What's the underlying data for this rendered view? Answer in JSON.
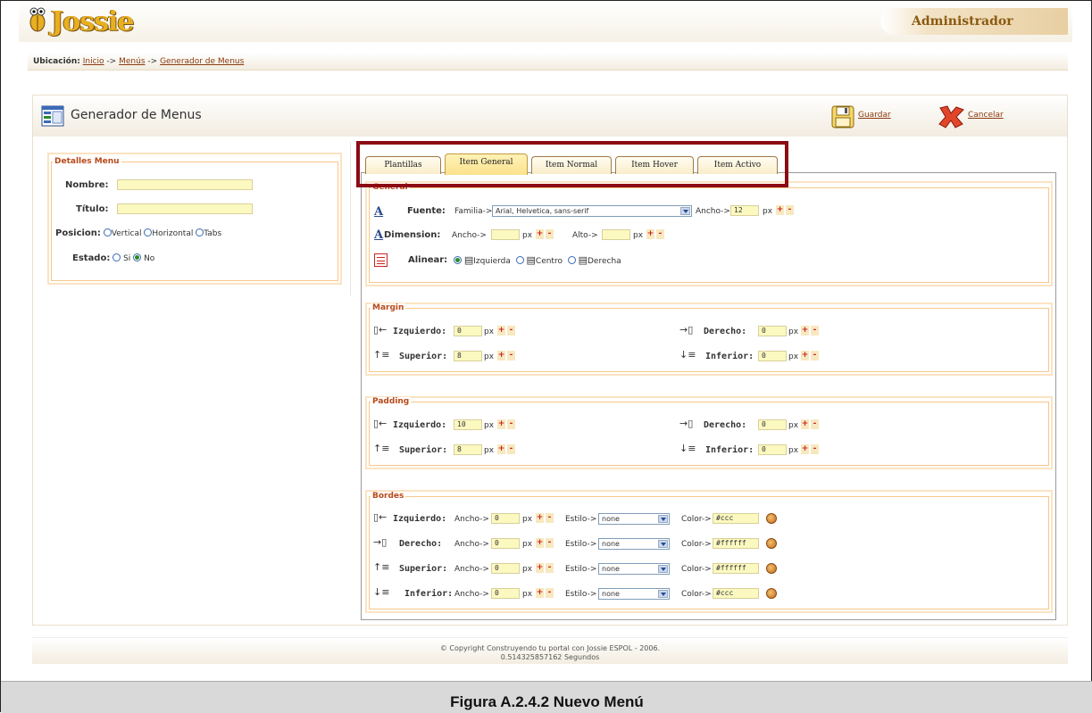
{
  "header": {
    "logo_text": "Jossie",
    "role": "Administrador"
  },
  "breadcrumb": {
    "label": "Ubicación:",
    "items": [
      "Inicio",
      "Menús",
      "Generador de Menus"
    ],
    "separator": "->"
  },
  "page": {
    "title": "Generador de Menus",
    "save_label": "Guardar",
    "cancel_label": "Cancelar"
  },
  "details": {
    "legend": "Detalles Menu",
    "nombre_label": "Nombre:",
    "nombre_value": "",
    "titulo_label": "Título:",
    "titulo_value": "",
    "posicion_label": "Posicion:",
    "posicion_options": [
      "Vertical",
      "Horizontal",
      "Tabs"
    ],
    "estado_label": "Estado:",
    "estado_options": [
      "Si",
      "No"
    ],
    "estado_selected": "No"
  },
  "tabs": [
    {
      "label": "Plantillas",
      "active": false
    },
    {
      "label": "Item General",
      "active": true
    },
    {
      "label": "Item Normal",
      "active": false
    },
    {
      "label": "Item Hover",
      "active": false
    },
    {
      "label": "Item Activo",
      "active": false
    }
  ],
  "general": {
    "legend": "General",
    "fuente_label": "Fuente:",
    "familia_label": "Familia->",
    "familia_value": "Arial, Helvetica, sans-serif",
    "ancho_label": "Ancho->",
    "ancho_value": "12",
    "unit": "px",
    "dimension_label": "Dimension:",
    "dim_ancho_label": "Ancho->",
    "dim_ancho_value": "",
    "alto_label": "Alto->",
    "alto_value": "",
    "alinear_label": "Alinear:",
    "align_options": [
      "Izquierda",
      "Centro",
      "Derecha"
    ],
    "align_selected": "Izquierda"
  },
  "margin": {
    "legend": "Margin",
    "izquierdo_label": "Izquierdo:",
    "izquierdo": "0",
    "derecho_label": "Derecho:",
    "derecho": "0",
    "superior_label": "Superior:",
    "superior": "8",
    "inferior_label": "Inferior:",
    "inferior": "0"
  },
  "padding": {
    "legend": "Padding",
    "izquierdo_label": "Izquierdo:",
    "izquierdo": "10",
    "derecho_label": "Derecho:",
    "derecho": "0",
    "superior_label": "Superior:",
    "superior": "8",
    "inferior_label": "Inferior:",
    "inferior": "0"
  },
  "bordes": {
    "legend": "Bordes",
    "ancho_label": "Ancho->",
    "estilo_label": "Estilo->",
    "color_label": "Color->",
    "rows": [
      {
        "label": "Izquierdo:",
        "ancho": "0",
        "estilo": "none",
        "color": "#ccc"
      },
      {
        "label": "Derecho:",
        "ancho": "0",
        "estilo": "none",
        "color": "#ffffff"
      },
      {
        "label": "Superior:",
        "ancho": "0",
        "estilo": "none",
        "color": "#ffffff"
      },
      {
        "label": "Inferior:",
        "ancho": "0",
        "estilo": "none",
        "color": "#ccc"
      }
    ]
  },
  "footer": {
    "copyright": "© Copyright Construyendo tu portal con Jossie ESPOL - 2006.",
    "timing": "0.514325857162 Segundos"
  },
  "caption": "Figura A.2.4.2 Nuevo Menú",
  "colors": {
    "accent": "#b8491a",
    "highlight_box": "#8b0a14",
    "input_bg": "#fbf9c0",
    "link": "#8a3a10"
  }
}
